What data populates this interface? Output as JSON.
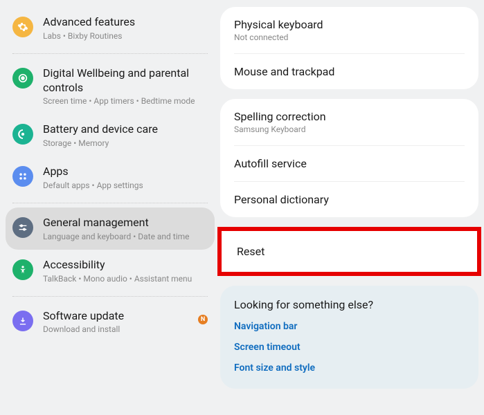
{
  "left": {
    "items": [
      {
        "title": "Advanced features",
        "sub": "Labs  •  Bixby Routines",
        "iconColor": "#f5b642",
        "icon": "gear"
      },
      {
        "divider": true
      },
      {
        "title": "Digital Wellbeing and parental controls",
        "sub": "Screen time  •  App timers  •  Bedtime mode",
        "iconColor": "#1eb16b",
        "icon": "target"
      },
      {
        "title": "Battery and device care",
        "sub": "Storage  •  Memory",
        "iconColor": "#1bb392",
        "icon": "spin"
      },
      {
        "title": "Apps",
        "sub": "Default apps  •  App settings",
        "iconColor": "#5b8def",
        "icon": "grid"
      },
      {
        "divider": true
      },
      {
        "title": "General management",
        "sub": "Language and keyboard  •  Date and time",
        "iconColor": "#5e6e82",
        "icon": "sliders",
        "selected": true
      },
      {
        "title": "Accessibility",
        "sub": "TalkBack  •  Mono audio  •  Assistant menu",
        "iconColor": "#1eb16b",
        "icon": "person"
      },
      {
        "divider": true
      },
      {
        "title": "Software update",
        "sub": "Download and install",
        "iconColor": "#7a6ef0",
        "icon": "download",
        "badge": "N"
      }
    ]
  },
  "right": {
    "card1": [
      {
        "title": "Physical keyboard",
        "sub": "Not connected"
      },
      {
        "title": "Mouse and trackpad"
      }
    ],
    "card2": [
      {
        "title": "Spelling correction",
        "sub": "Samsung Keyboard"
      },
      {
        "title": "Autofill service"
      },
      {
        "title": "Personal dictionary"
      }
    ],
    "card3": [
      {
        "title": "Reset"
      }
    ],
    "looking": {
      "title": "Looking for something else?",
      "links": [
        "Navigation bar",
        "Screen timeout",
        "Font size and style"
      ]
    }
  }
}
